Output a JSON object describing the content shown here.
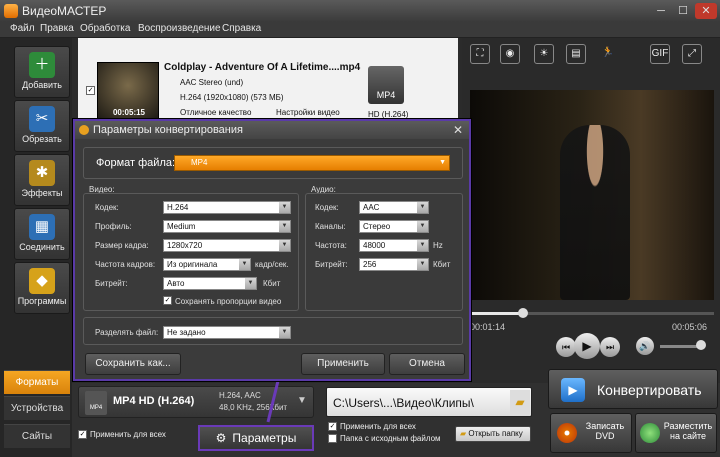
{
  "app": {
    "title": "ВидеоМАСТЕР"
  },
  "menu": [
    "Файл",
    "Правка",
    "Обработка",
    "Воспроизведение",
    "Справка"
  ],
  "sidebar": {
    "buttons": [
      {
        "label": "Добавить",
        "icon": "plus-film-icon"
      },
      {
        "label": "Обрезать",
        "icon": "scissors-icon"
      },
      {
        "label": "Эффекты",
        "icon": "effects-icon"
      },
      {
        "label": "Соединить",
        "icon": "join-icon"
      },
      {
        "label": "Программы",
        "icon": "programs-icon"
      }
    ],
    "tabs": [
      "Форматы",
      "Устройства",
      "Сайты"
    ]
  },
  "file": {
    "name": "Coldplay - Adventure Of A Lifetime....mp4",
    "audio": "AAC Stereo (und)",
    "video": "H.264 (1920x1080) (573 МБ)",
    "duration": "00:05:15",
    "quality": "Отличное качество",
    "settings_link": "Настройки видео",
    "badge": "MP4",
    "badge_hd": "HD",
    "output": "HD (H.264)"
  },
  "preview": {
    "time_current": "00:01:14",
    "time_total": "00:05:06",
    "gif": "GIF"
  },
  "dialog": {
    "title": "Параметры конвертирования",
    "format_label": "Формат файла:",
    "format_value": "MP4",
    "video_heading": "Видео:",
    "audio_heading": "Аудио:",
    "video": {
      "codec_label": "Кодек:",
      "codec": "H.264",
      "profile_label": "Профиль:",
      "profile": "Medium",
      "size_label": "Размер кадра:",
      "size": "1280x720",
      "fps_label": "Частота кадров:",
      "fps": "Из оригинала",
      "fps_unit": "кадр/сек.",
      "bitrate_label": "Битрейт:",
      "bitrate": "Авто",
      "bitrate_unit": "Кбит",
      "keep_ratio": "Сохранять пропорции видео"
    },
    "audio": {
      "codec_label": "Кодек:",
      "codec": "AAC",
      "channels_label": "Каналы:",
      "channels": "Стерео",
      "freq_label": "Частота:",
      "freq": "48000",
      "freq_unit": "Hz",
      "bitrate_label": "Битрейт:",
      "bitrate": "256",
      "bitrate_unit": "Кбит"
    },
    "split_label": "Разделять файл:",
    "split_value": "Не задано",
    "save_as": "Сохранить как...",
    "apply": "Применить",
    "cancel": "Отмена"
  },
  "bottom": {
    "format_name": "MP4 HD (H.264)",
    "format_info1": "H.264, AAC",
    "format_info2": "48,0 KHz, 256Кбит",
    "format_badge": "MP4",
    "apply_all": "Применить для всех",
    "params": "Параметры",
    "path": "C:\\Users\\...\\Видео\\Клипы\\",
    "apply_all2": "Применить для всех",
    "source_folder": "Папка с исходным файлом",
    "open_folder": "Открыть папку",
    "convert": "Конвертировать",
    "burn_dvd": "Записать DVD",
    "publish": "Разместить на сайте"
  }
}
